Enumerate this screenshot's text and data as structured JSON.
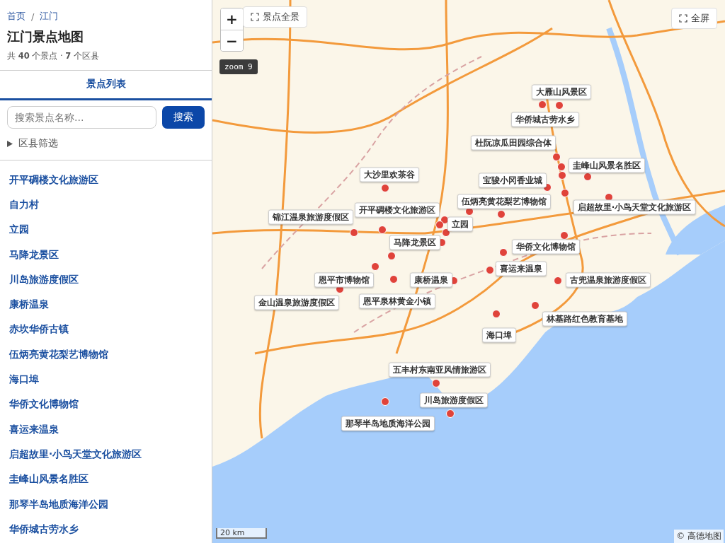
{
  "breadcrumb": [
    {
      "label": "首页"
    },
    {
      "label": "江门"
    }
  ],
  "breadcrumb_separator": "/",
  "title": "江门景点地图",
  "summary": "共 **40** 个景点 · **7** 个区县",
  "tabs": [
    {
      "label": "景点列表",
      "selected": true
    }
  ],
  "search": {
    "placeholder": "搜索景点名称…",
    "button": "搜索"
  },
  "filter": {
    "label": "区县筛选",
    "expanded": false
  },
  "spots": [
    "开平碉楼文化旅游区",
    "自力村",
    "立园",
    "马降龙景区",
    "川岛旅游度假区",
    "康桥温泉",
    "赤坎华侨古镇",
    "伍炳亮黄花梨艺博物馆",
    "海口埠",
    "华侨文化博物馆",
    "喜运来温泉",
    "启超故里·小鸟天堂文化旅游区",
    "圭峰山风景名胜区",
    "那琴半岛地质海洋公园",
    "华侨城古劳水乡"
  ],
  "map": {
    "zoom_in": "+",
    "zoom_out": "−",
    "overview_button": "景点全景",
    "fullscreen_button": "全屏",
    "zoom_badge": "zoom 9",
    "scale": "20 km",
    "attribution": "© 高德地图",
    "markers": [
      "大雁山风景区",
      "华侨城古劳水乡",
      "杜阮凉瓜田园综合体",
      "圭峰山风景名胜区",
      "大沙里欢茶谷",
      "宝骏小冈香业城",
      "伍炳亮黄花梨艺博物馆",
      "开平碉楼文化旅游区",
      "锦江温泉旅游度假区",
      "立园",
      "启超故里·小鸟天堂文化旅游区",
      "马降龙景区",
      "华侨文化博物馆",
      "喜运来温泉",
      "恩平市博物馆",
      "康桥温泉",
      "古兜温泉旅游度假区",
      "金山温泉旅游度假区",
      "恩平泉林黄金小镇",
      "林基路红色教育基地",
      "海口埠",
      "五丰村东南亚风情旅游区",
      "川岛旅游度假区",
      "那琴半岛地质海洋公园"
    ]
  }
}
